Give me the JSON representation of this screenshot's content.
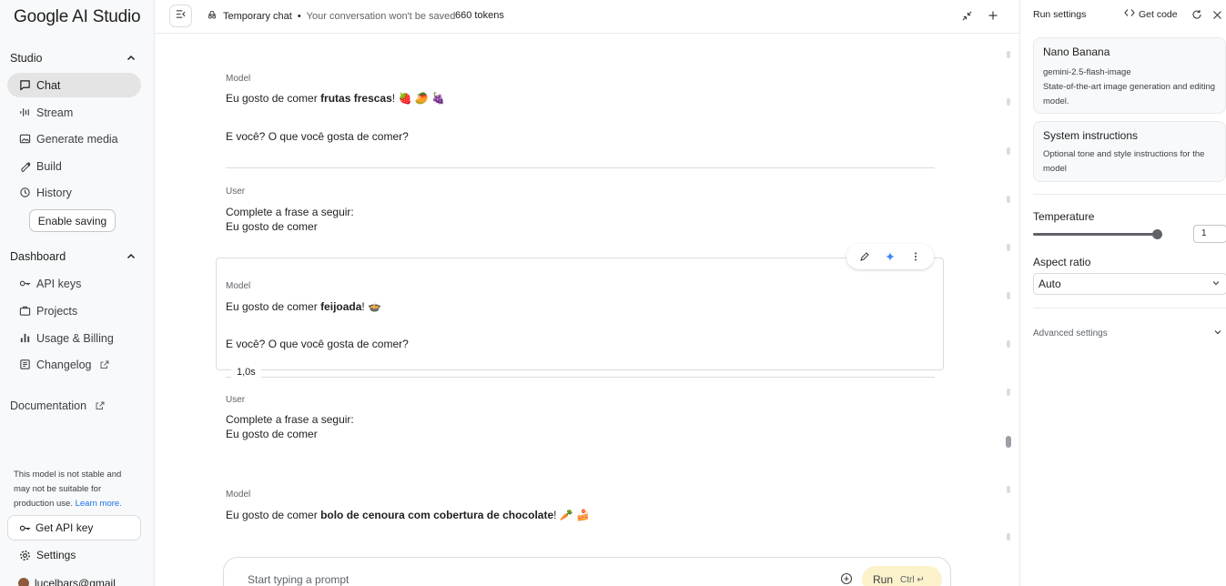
{
  "app": {
    "logo_text": "Google AI Studio"
  },
  "sidebar": {
    "studio_heading": "Studio",
    "studio_items": [
      {
        "label": "Chat",
        "icon": "chat-icon",
        "active": true
      },
      {
        "label": "Stream",
        "icon": "stream-icon"
      },
      {
        "label": "Generate media",
        "icon": "media-icon"
      },
      {
        "label": "Build",
        "icon": "build-icon"
      },
      {
        "label": "History",
        "icon": "history-icon"
      }
    ],
    "enable_saving": "Enable saving",
    "dashboard_heading": "Dashboard",
    "dashboard_items": [
      {
        "label": "API keys",
        "icon": "key-icon"
      },
      {
        "label": "Projects",
        "icon": "folder-icon"
      },
      {
        "label": "Usage & Billing",
        "icon": "bar-chart-icon"
      },
      {
        "label": "Changelog",
        "icon": "changelog-icon"
      }
    ],
    "documentation": "Documentation",
    "notice_text": "This model is not stable and may not be suitable for production use.",
    "notice_link": "Learn more.",
    "get_api_key": "Get API key",
    "settings": "Settings",
    "user": "lucelbars@gmail"
  },
  "topbar": {
    "temp_chat": "Temporary chat",
    "temp_chat_sub": "Your conversation won't be saved",
    "tokens": "660 tokens"
  },
  "chat": {
    "messages": [
      {
        "role": "Model",
        "line1_pre": "Eu gosto de comer ",
        "line1_bold": "frutas frescas",
        "line1_post": "! 🍓 🥭 🍇",
        "line2": "E você? O que você gosta de comer?"
      },
      {
        "role": "User",
        "line1": "Complete a frase a seguir:",
        "line2": "Eu gosto de comer"
      },
      {
        "role": "Model",
        "line1_pre": "Eu gosto de comer ",
        "line1_bold": "feijoada",
        "line1_post": "! 🍲",
        "line2": "E você? O que você gosta de comer?"
      },
      {
        "role": "User",
        "line1": "Complete a frase a seguir:",
        "line2": "Eu gosto de comer"
      },
      {
        "role": "Model",
        "line1_pre": "Eu gosto de comer ",
        "line1_bold": "bolo de cenoura com cobertura de chocolate",
        "line1_post": "! 🥕 🍰"
      }
    ],
    "timing": "1,0s",
    "prompt_placeholder": "Start typing a prompt",
    "run_label": "Run",
    "run_shortcut": "Ctrl ↵"
  },
  "run_settings": {
    "title": "Run settings",
    "get_code": "Get code",
    "model_name": "Nano Banana",
    "model_id": "gemini-2.5-flash-image",
    "model_desc": "State-of-the-art image generation and editing model.",
    "system_title": "System instructions",
    "system_desc": "Optional tone and style instructions for the model",
    "temperature_label": "Temperature",
    "temperature_value": "1",
    "aspect_label": "Aspect ratio",
    "aspect_value": "Auto",
    "advanced": "Advanced settings"
  }
}
